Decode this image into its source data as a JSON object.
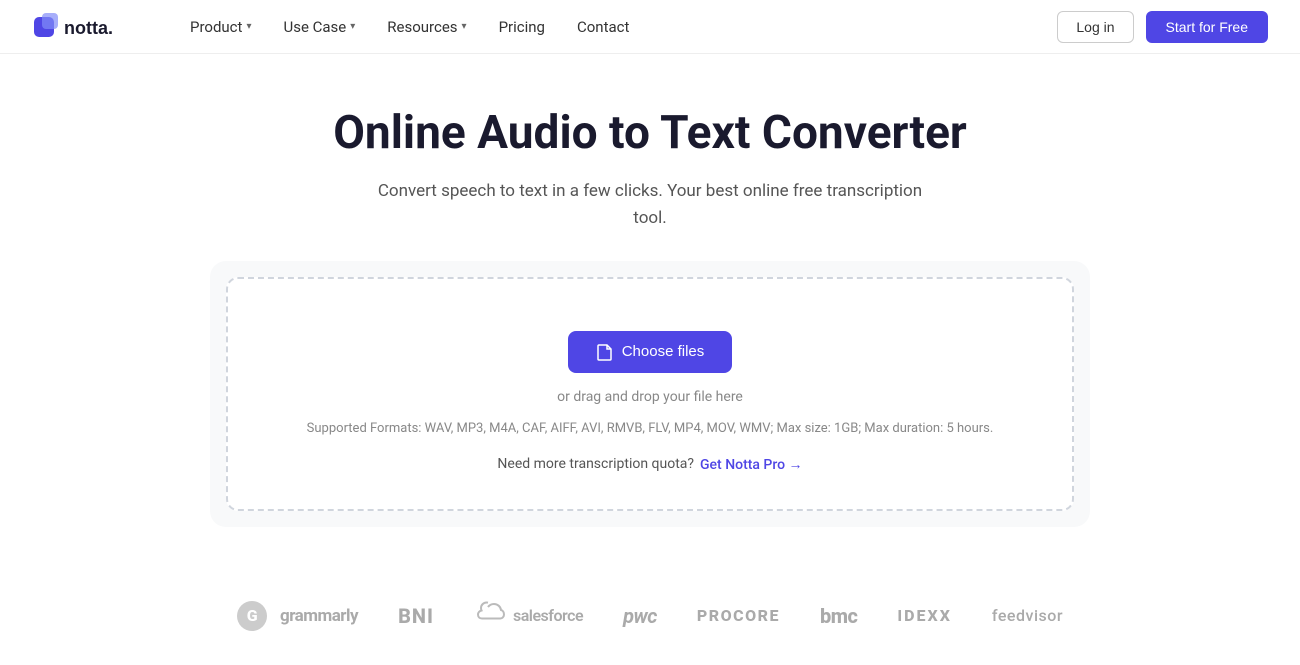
{
  "brand": {
    "name": "notta",
    "logo_text": "notta."
  },
  "nav": {
    "links": [
      {
        "id": "product",
        "label": "Product",
        "has_dropdown": true
      },
      {
        "id": "use-case",
        "label": "Use Case",
        "has_dropdown": true
      },
      {
        "id": "resources",
        "label": "Resources",
        "has_dropdown": true
      },
      {
        "id": "pricing",
        "label": "Pricing",
        "has_dropdown": false
      },
      {
        "id": "contact",
        "label": "Contact",
        "has_dropdown": false
      }
    ],
    "login_label": "Log in",
    "start_label": "Start for Free"
  },
  "hero": {
    "title": "Online Audio to Text Converter",
    "subtitle": "Convert speech to text in a few clicks. Your best online free transcription tool."
  },
  "upload": {
    "choose_label": "Choose files",
    "or_text": "or drag and drop your file here",
    "formats_label": "Supported Formats: WAV, MP3, M4A, CAF, AIFF, AVI, RMVB, FLV, MP4, MOV, WMV; Max size: 1GB; Max duration: 5 hours.",
    "quota_label": "Need more transcription quota?",
    "quota_link_label": "Get Notta Pro →"
  },
  "logos": [
    {
      "id": "grammarly",
      "label": "grammarly",
      "prefix": "G"
    },
    {
      "id": "bni",
      "label": "BNI"
    },
    {
      "id": "salesforce",
      "label": "salesforce"
    },
    {
      "id": "pwc",
      "label": "pwc"
    },
    {
      "id": "procore",
      "label": "PROCORE"
    },
    {
      "id": "bmc",
      "label": "bmc"
    },
    {
      "id": "idexx",
      "label": "IDEXX"
    },
    {
      "id": "feedvisor",
      "label": "feedvisor"
    }
  ],
  "colors": {
    "primary": "#4f46e5",
    "primary_hover": "#4338ca",
    "text_dark": "#1a1a2e",
    "text_muted": "#555",
    "text_light": "#888",
    "logo_gray": "#aaa"
  }
}
